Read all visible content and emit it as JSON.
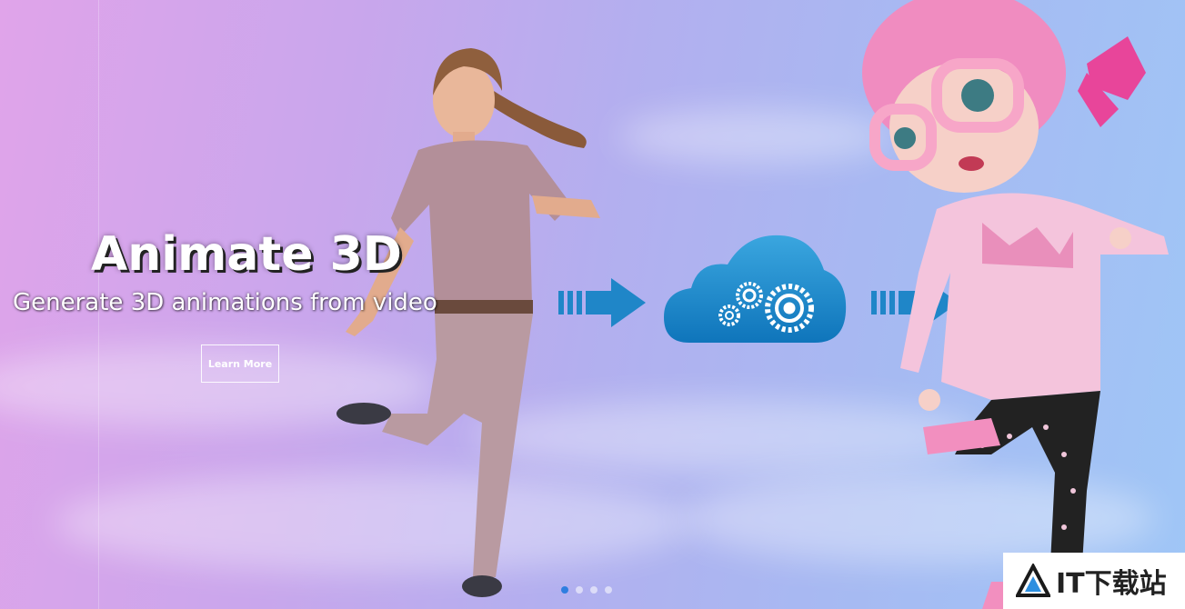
{
  "hero": {
    "title": "Animate 3D",
    "subtitle": "Generate 3D animations from video",
    "cta_label": "Learn More"
  },
  "carousel": {
    "slide_count": 4,
    "active_index": 0,
    "active_color": "#2f7ee0"
  },
  "flow": {
    "arrow_color": "#1f86c8",
    "cloud_icon": "cloud-gears-icon",
    "arrow_icon": "right-arrow-icon"
  },
  "watermark": {
    "text": "IT下载站",
    "icon": "triangle-logo-icon"
  }
}
